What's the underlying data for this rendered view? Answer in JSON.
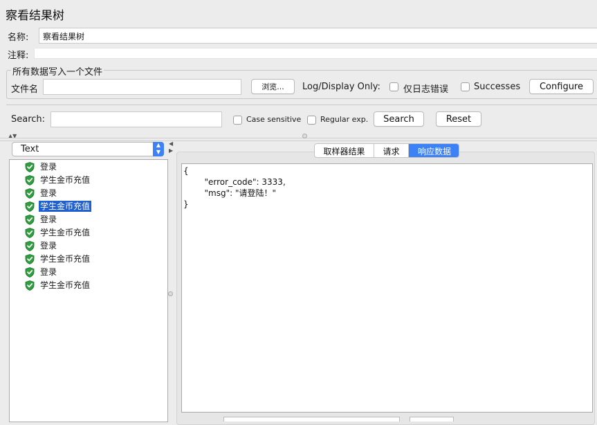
{
  "window": {
    "title": "察看结果树"
  },
  "form": {
    "name_label": "名称:",
    "name_value": "察看结果树",
    "comment_label": "注释:",
    "comment_value": ""
  },
  "file_group": {
    "legend": "所有数据写入一个文件",
    "filename_label": "文件名",
    "filename_value": "",
    "browse_label": "浏览...",
    "log_display_label": "Log/Display Only:",
    "errors_only_label": "仅日志错误",
    "errors_only_checked": false,
    "successes_label": "Successes",
    "successes_checked": false,
    "configure_label": "Configure"
  },
  "search": {
    "label": "Search:",
    "value": "",
    "case_sensitive_label": "Case sensitive",
    "case_sensitive_checked": false,
    "regex_label": "Regular exp.",
    "regex_checked": false,
    "search_button": "Search",
    "reset_button": "Reset"
  },
  "renderer": {
    "selected": "Text"
  },
  "tree": {
    "items": [
      {
        "label": "登录",
        "status": "success"
      },
      {
        "label": "学生金币充值",
        "status": "success"
      },
      {
        "label": "登录",
        "status": "success"
      },
      {
        "label": "学生金币充值",
        "status": "success",
        "selected": true
      },
      {
        "label": "登录",
        "status": "success"
      },
      {
        "label": "学生金币充值",
        "status": "success"
      },
      {
        "label": "登录",
        "status": "success"
      },
      {
        "label": "学生金币充值",
        "status": "success"
      },
      {
        "label": "登录",
        "status": "success"
      },
      {
        "label": "学生金币充值",
        "status": "success"
      }
    ]
  },
  "tabs": [
    {
      "label": "取样器结果",
      "active": false
    },
    {
      "label": "请求",
      "active": false
    },
    {
      "label": "响应数据",
      "active": true
    }
  ],
  "response": {
    "text": "{\n        \"error_code\": 3333,\n        \"msg\": \"请登陆！\"\n}"
  },
  "colors": {
    "accent": "#3c82f6",
    "selection": "#1f5fce",
    "success": "#2e9e3e"
  }
}
